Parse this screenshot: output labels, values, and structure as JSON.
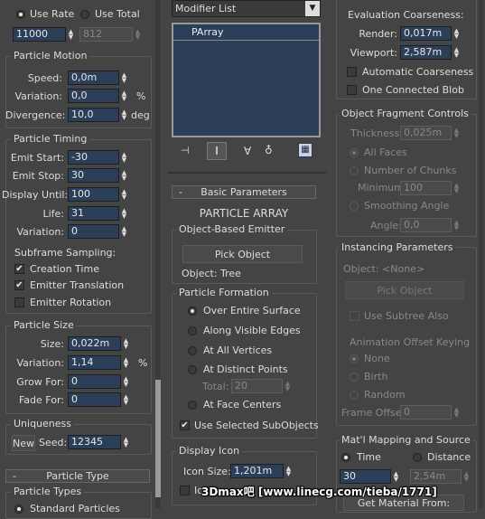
{
  "left": {
    "top": {
      "use_rate": "Use Rate",
      "use_total": "Use Total",
      "rate_value": "11000",
      "total_value": "812"
    },
    "motion": {
      "title": "Particle Motion",
      "speed_label": "Speed:",
      "speed": "0,0m",
      "variation_label": "Variation:",
      "variation": "0,0",
      "pct": "%",
      "divergence_label": "Divergence:",
      "divergence": "10,0",
      "deg": "deg"
    },
    "timing": {
      "title": "Particle Timing",
      "emit_start_label": "Emit Start:",
      "emit_start": "-30",
      "emit_stop_label": "Emit Stop:",
      "emit_stop": "30",
      "display_until_label": "Display Until:",
      "display_until": "100",
      "life_label": "Life:",
      "life": "31",
      "variation_label": "Variation:",
      "variation": "0",
      "subframe_label": "Subframe Sampling:",
      "creation_time": "Creation Time",
      "emitter_translation": "Emitter Translation",
      "emitter_rotation": "Emitter Rotation"
    },
    "size": {
      "title": "Particle Size",
      "size_label": "Size:",
      "size": "0,022m",
      "variation_label": "Variation:",
      "variation": "1,14",
      "pct": "%",
      "grow_label": "Grow For:",
      "grow": "0",
      "fade_label": "Fade For:",
      "fade": "0"
    },
    "uniqueness": {
      "title": "Uniqueness",
      "new_button": "New",
      "seed_label": "Seed:",
      "seed": "12345"
    },
    "particle_type": {
      "rollout": "Particle Type",
      "group_title": "Particle Types",
      "standard": "Standard Particles"
    }
  },
  "middle": {
    "modifier_list": "Modifier List",
    "stack_item": "PArray",
    "basic": {
      "rollout": "Basic Parameters",
      "heading": "PARTICLE ARRAY",
      "emitter_group": "Object-Based Emitter",
      "pick_object": "Pick Object",
      "object_label": "Object: Tree"
    },
    "formation": {
      "title": "Particle Formation",
      "over_surface": "Over Entire Surface",
      "along_edges": "Along Visible Edges",
      "at_vertices": "At All Vertices",
      "at_points": "At Distinct Points",
      "total_label": "Total:",
      "total": "20",
      "at_face_centers": "At Face Centers",
      "use_subobjects": "Use Selected SubObjects"
    },
    "display_icon": {
      "title": "Display Icon",
      "icon_size_label": "Icon Size:",
      "icon_size": "1,201m",
      "icon_hidden": "Icon Hidden"
    }
  },
  "right": {
    "evaluation": {
      "label": "Evaluation Coarseness:",
      "render_label": "Render:",
      "render": "0,017m",
      "viewport_label": "Viewport:",
      "viewport": "2,587m",
      "auto_coarse": "Automatic Coarseness",
      "one_connected": "One Connected Blob"
    },
    "fragment": {
      "title": "Object Fragment Controls",
      "thickness_label": "Thickness:",
      "thickness": "0,025m",
      "all_faces": "All Faces",
      "num_chunks": "Number of Chunks",
      "minimum_label": "Minimum:",
      "minimum": "100",
      "smoothing_angle": "Smoothing Angle",
      "angle_label": "Angle:",
      "angle": "0,0"
    },
    "instancing": {
      "title": "Instancing Parameters",
      "object_label": "Object: <None>",
      "pick_object": "Pick Object",
      "use_subtree": "Use Subtree Also",
      "anim_offset": "Animation Offset Keying",
      "none": "None",
      "birth": "Birth",
      "random": "Random",
      "frame_offset_label": "Frame Offset:",
      "frame_offset": "0"
    },
    "material": {
      "title": "Mat'l Mapping and Source",
      "time": "Time",
      "distance": "Distance",
      "time_value": "30",
      "distance_value": "2,54m",
      "get_material": "Get Material From:"
    }
  },
  "watermark": "3Dmax吧 [www.linecg.com/tieba/1771]"
}
